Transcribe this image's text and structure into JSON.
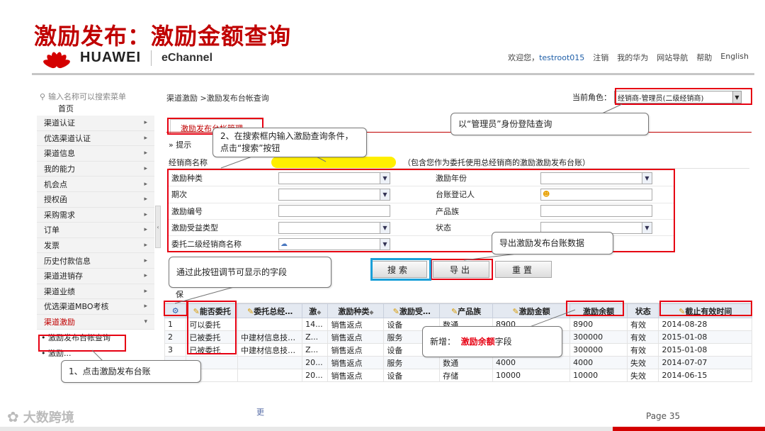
{
  "slide": {
    "title": "激励发布：激励金额查询",
    "footer_text": "更",
    "page": "Page 35",
    "footer_logo": "大数跨境"
  },
  "header": {
    "brand": "HUAWEI",
    "app": "eChannel",
    "welcome": "欢迎您，",
    "user": "testroot015",
    "links": [
      "注销",
      "我的华为",
      "网站导航",
      "帮助",
      "English"
    ]
  },
  "sidebar": {
    "search_placeholder": "输入名称可以搜索菜单",
    "home": "首页",
    "items": [
      "渠道认证",
      "优选渠道认证",
      "渠道信息",
      "我的能力",
      "机会点",
      "授权函",
      "采购需求",
      "订单",
      "发票",
      "历史付款信息",
      "渠道进销存",
      "渠道业绩",
      "优选渠道MBO考核",
      "渠道激励"
    ],
    "active_item": "渠道激励",
    "subitems": [
      "激励发布台帐查询",
      "激励..."
    ]
  },
  "main": {
    "breadcrumb": "渠道激励 >激励发布台帐查询",
    "role_label": "当前角色：",
    "role_value": "经销商-管理员(二级经销商)",
    "tab": "激励发布台帐管理",
    "hint": "» 提示",
    "dealer_label": "经销商名称",
    "dealer_note": "（包含您作为委托使用总经销商的激励激励发布台账）",
    "form": [
      {
        "l1": "激励种类",
        "t1": "select",
        "l2": "激励年份",
        "t2": "select"
      },
      {
        "l1": "期次",
        "t1": "select",
        "l2": "台账登记人",
        "t2": "person"
      },
      {
        "l1": "激励编号",
        "t1": "text",
        "l2": "产品族",
        "t2": "text"
      },
      {
        "l1": "激励受益类型",
        "t1": "select",
        "l2": "状态",
        "t2": "select"
      },
      {
        "l1": "委托二级经销商名称",
        "t1": "lookup",
        "l2": "",
        "t2": ""
      }
    ],
    "buttons": {
      "search": "搜索",
      "export": "导出",
      "reset": "重置"
    },
    "table_toolbar": "保",
    "table": {
      "headers": [
        "",
        "能否委托",
        "委托总经…",
        "激",
        "激励种类",
        "激励受…",
        "产品族",
        "激励金额",
        "激励余额",
        "状态",
        "截止有效时间"
      ],
      "rows": [
        [
          "1",
          "可以委托",
          "",
          "14...",
          "销售返点",
          "设备",
          "数通",
          "8900",
          "8900",
          "有效",
          "2014-08-28"
        ],
        [
          "2",
          "已被委托",
          "中建材信息技…",
          "Z...",
          "销售返点",
          "服务",
          "",
          "",
          "300000",
          "有效",
          "2015-01-08"
        ],
        [
          "3",
          "已被委托",
          "中建材信息技…",
          "Z...",
          "销售返点",
          "设备",
          "",
          "",
          "300000",
          "有效",
          "2015-01-08"
        ],
        [
          "",
          "",
          "",
          "20...",
          "销售返点",
          "服务",
          "数通",
          "4000",
          "4000",
          "失效",
          "2014-07-07"
        ],
        [
          "",
          "",
          "",
          "20...",
          "销售返点",
          "设备",
          "存储",
          "10000",
          "10000",
          "失效",
          "2014-06-15"
        ]
      ]
    }
  },
  "callouts": {
    "login": "以“管理员”身份登陆查询",
    "search_step": "2、在搜索框内输入激励查询条件，点击“搜索”按钮",
    "export": "导出激励发布台账数据",
    "columns": "通过此按钮调节可显示的字段",
    "new_prefix": "新增：",
    "new_field": "激励余额",
    "new_suffix": "字段",
    "step1": "1、点击激励发布台账"
  },
  "colors": {
    "accent": "#c00000",
    "highlight_box": "#e60012",
    "search_box": "#1aa0d8",
    "dealer_highlight": "#ffef00"
  }
}
